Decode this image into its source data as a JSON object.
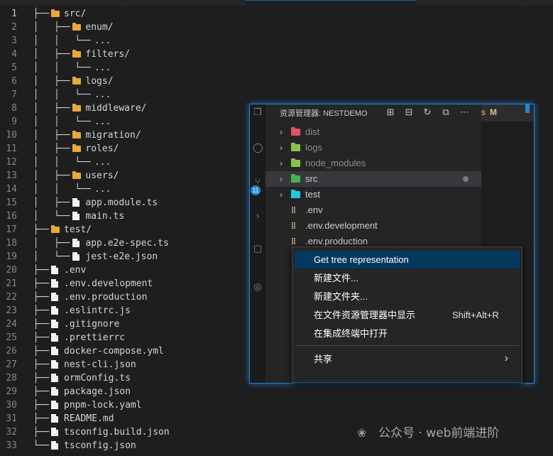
{
  "editor": {
    "current_line": 1,
    "lines": [
      {
        "n": "1",
        "guide": "  ├──",
        "icon": "folder",
        "name": "src/"
      },
      {
        "n": "2",
        "guide": "  │   ├──",
        "icon": "folder",
        "name": "enum/"
      },
      {
        "n": "3",
        "guide": "  │   │   └──",
        "icon": "",
        "name": "..."
      },
      {
        "n": "4",
        "guide": "  │   ├──",
        "icon": "folder",
        "name": "filters/"
      },
      {
        "n": "5",
        "guide": "  │   │   └──",
        "icon": "",
        "name": "..."
      },
      {
        "n": "6",
        "guide": "  │   ├──",
        "icon": "folder",
        "name": "logs/"
      },
      {
        "n": "7",
        "guide": "  │   │   └──",
        "icon": "",
        "name": "..."
      },
      {
        "n": "8",
        "guide": "  │   ├──",
        "icon": "folder",
        "name": "middleware/"
      },
      {
        "n": "9",
        "guide": "  │   │   └──",
        "icon": "",
        "name": "..."
      },
      {
        "n": "10",
        "guide": "  │   ├──",
        "icon": "folder",
        "name": "migration/"
      },
      {
        "n": "11",
        "guide": "  │   ├──",
        "icon": "folder",
        "name": "roles/"
      },
      {
        "n": "12",
        "guide": "  │   │   └──",
        "icon": "",
        "name": "..."
      },
      {
        "n": "13",
        "guide": "  │   ├──",
        "icon": "folder",
        "name": "users/"
      },
      {
        "n": "14",
        "guide": "  │   │   └──",
        "icon": "",
        "name": "..."
      },
      {
        "n": "15",
        "guide": "  │   ├──",
        "icon": "file",
        "name": "app.module.ts"
      },
      {
        "n": "16",
        "guide": "  │   └──",
        "icon": "file",
        "name": "main.ts"
      },
      {
        "n": "17",
        "guide": "  ├──",
        "icon": "folder",
        "name": "test/"
      },
      {
        "n": "18",
        "guide": "  │   ├──",
        "icon": "file",
        "name": "app.e2e-spec.ts"
      },
      {
        "n": "19",
        "guide": "  │   └──",
        "icon": "file",
        "name": "jest-e2e.json"
      },
      {
        "n": "20",
        "guide": "  ├──",
        "icon": "file",
        "name": ".env"
      },
      {
        "n": "21",
        "guide": "  ├──",
        "icon": "file",
        "name": ".env.development"
      },
      {
        "n": "22",
        "guide": "  ├──",
        "icon": "file",
        "name": ".env.production"
      },
      {
        "n": "23",
        "guide": "  ├──",
        "icon": "file",
        "name": ".eslintrc.js"
      },
      {
        "n": "24",
        "guide": "  ├──",
        "icon": "file",
        "name": ".gitignore"
      },
      {
        "n": "25",
        "guide": "  ├──",
        "icon": "file",
        "name": ".prettierrc"
      },
      {
        "n": "26",
        "guide": "  ├──",
        "icon": "file",
        "name": "docker-compose.yml"
      },
      {
        "n": "27",
        "guide": "  ├──",
        "icon": "file",
        "name": "nest-cli.json"
      },
      {
        "n": "28",
        "guide": "  ├──",
        "icon": "file",
        "name": "ormConfig.ts"
      },
      {
        "n": "29",
        "guide": "  ├──",
        "icon": "file",
        "name": "package.json"
      },
      {
        "n": "30",
        "guide": "  ├──",
        "icon": "file",
        "name": "pnpm-lock.yaml"
      },
      {
        "n": "31",
        "guide": "  ├──",
        "icon": "file",
        "name": "README.md"
      },
      {
        "n": "32",
        "guide": "  ├──",
        "icon": "file",
        "name": "tsconfig.build.json"
      },
      {
        "n": "33",
        "guide": "  └──",
        "icon": "file",
        "name": "tsconfig.json"
      }
    ]
  },
  "explorer": {
    "title": "资源管理器: NESTDEMO",
    "background_tab": {
      "suffix": "s",
      "status": "M"
    },
    "badge_count": "11",
    "items": [
      {
        "name": "dist",
        "kind": "folder",
        "color": "#e05561",
        "chevron": "›",
        "dim": true,
        "modified": false,
        "selected": false
      },
      {
        "name": "logs",
        "kind": "folder",
        "color": "#8bc34a",
        "chevron": "›",
        "dim": true,
        "modified": false,
        "selected": false
      },
      {
        "name": "node_modules",
        "kind": "folder",
        "color": "#8bc34a",
        "chevron": "›",
        "dim": true,
        "modified": false,
        "selected": false
      },
      {
        "name": "src",
        "kind": "folder",
        "color": "#4caf50",
        "chevron": "›",
        "dim": false,
        "modified": true,
        "selected": true
      },
      {
        "name": "test",
        "kind": "folder",
        "color": "#26c6da",
        "chevron": "›",
        "dim": false,
        "modified": false,
        "selected": false
      },
      {
        "name": ".env",
        "kind": "env",
        "color": "#e2c08d",
        "chevron": "",
        "dim": false,
        "modified": false,
        "selected": false
      },
      {
        "name": ".env.development",
        "kind": "env",
        "color": "#e2c08d",
        "chevron": "",
        "dim": false,
        "modified": false,
        "selected": false
      },
      {
        "name": ".env.production",
        "kind": "env",
        "color": "#e2c08d",
        "chevron": "",
        "dim": false,
        "modified": false,
        "selected": false
      }
    ]
  },
  "context_menu": {
    "items": [
      {
        "label": "Get tree representation",
        "shortcut": "",
        "submenu": false,
        "highlighted": true
      },
      {
        "label": "新建文件...",
        "shortcut": "",
        "submenu": false,
        "highlighted": false
      },
      {
        "label": "新建文件夹...",
        "shortcut": "",
        "submenu": false,
        "highlighted": false
      },
      {
        "label": "在文件资源管理器中显示",
        "shortcut": "Shift+Alt+R",
        "submenu": false,
        "highlighted": false
      },
      {
        "label": "在集成终端中打开",
        "shortcut": "",
        "submenu": false,
        "highlighted": false
      },
      {
        "label": "共享",
        "shortcut": "",
        "submenu": true,
        "highlighted": false
      }
    ]
  },
  "watermark": {
    "text": "公众号 · web前端进阶"
  },
  "colors": {
    "accent": "#0e639c",
    "menu_highlight": "#04395e",
    "folder_icon": "#e8a93a"
  }
}
